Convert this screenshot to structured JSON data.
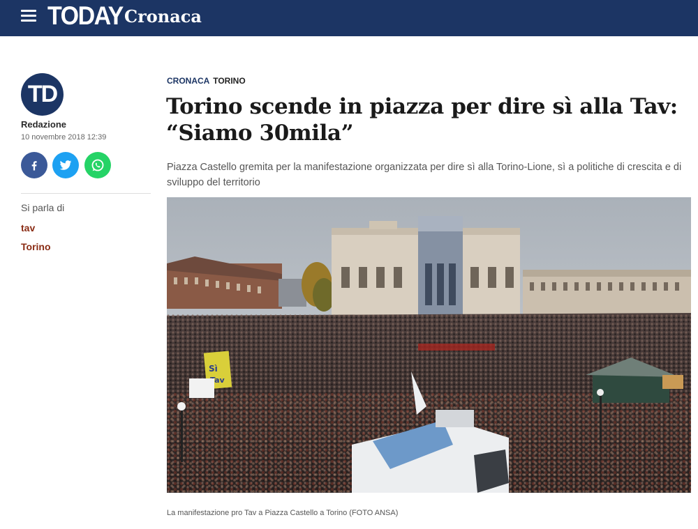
{
  "header": {
    "brand": "TODAY",
    "section": "Cronaca",
    "background": "#1c3564"
  },
  "sidebar": {
    "logo_text": "TD",
    "author": "Redazione",
    "date": "10 novembre 2018 12:39",
    "share_icons": [
      "facebook-icon",
      "twitter-icon",
      "whatsapp-icon"
    ],
    "talk_label": "Si parla di",
    "tags": [
      "tav",
      "Torino"
    ],
    "tag_color": "#8a2c14"
  },
  "article": {
    "kicker_category": "CRONACA",
    "kicker_city": "TORINO",
    "headline_line1": "Torino scende in piazza per dire sì alla Tav:",
    "headline_line2": "“Siamo 30mila”",
    "summary": "Piazza Castello gremita per la manifestazione organizzata per dire sì alla Torino-Lione, sì a politiche di crescita e di sviluppo del territorio",
    "caption": "La manifestazione pro Tav a Piazza Castello a Torino (FOTO ANSA)",
    "photo_banner_1": "Sì",
    "photo_banner_2": "Tav"
  }
}
